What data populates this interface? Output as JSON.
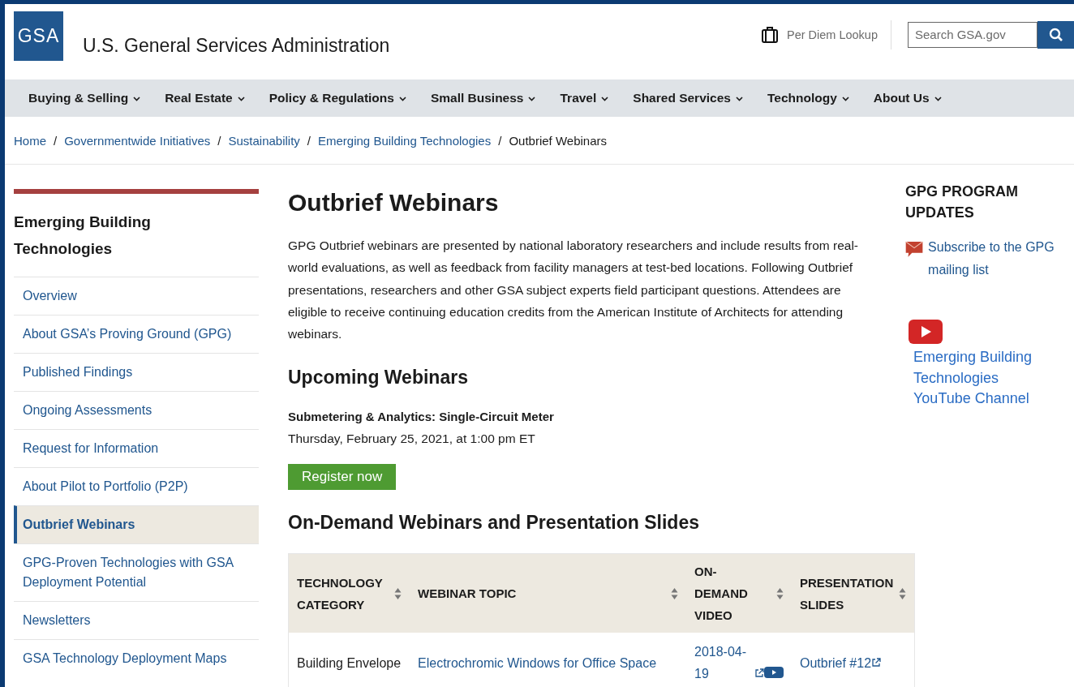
{
  "header": {
    "logo": "GSA",
    "title": "U.S. General Services Administration",
    "per_diem": "Per Diem Lookup",
    "search": {
      "placeholder": "Search GSA.gov"
    }
  },
  "nav": [
    {
      "label": "Buying & Selling"
    },
    {
      "label": "Real Estate"
    },
    {
      "label": "Policy & Regulations"
    },
    {
      "label": "Small Business"
    },
    {
      "label": "Travel"
    },
    {
      "label": "Shared Services"
    },
    {
      "label": "Technology"
    },
    {
      "label": "About Us"
    }
  ],
  "breadcrumb": [
    {
      "label": "Home",
      "current": false
    },
    {
      "separator": "/",
      "label": "Governmentwide Initiatives",
      "current": false
    },
    {
      "separator": "/",
      "label": "Sustainability",
      "current": false
    },
    {
      "separator": "/",
      "label": "Emerging Building Technologies",
      "current": false
    },
    {
      "separator": "/",
      "label": "Outbrief Webinars",
      "current": true
    }
  ],
  "sidebar": {
    "title": "Emerging Building Technologies",
    "items": [
      {
        "label": "Overview",
        "selected": false
      },
      {
        "label": "About GSA’s Proving Ground (GPG)",
        "selected": false
      },
      {
        "label": "Published Findings",
        "selected": false
      },
      {
        "label": "Ongoing Assessments",
        "selected": false
      },
      {
        "label": "Request for Information",
        "selected": false
      },
      {
        "label": "About Pilot to Portfolio (P2P)",
        "selected": false
      },
      {
        "label": "Outbrief Webinars",
        "selected": true
      },
      {
        "label": "GPG-Proven Technologies with GSA Deployment Potential",
        "selected": false
      },
      {
        "label": "Newsletters",
        "selected": false
      },
      {
        "label": "GSA Technology Deployment Maps",
        "selected": false
      }
    ]
  },
  "main": {
    "title": "Outbrief Webinars",
    "intro": "GPG Outbrief webinars are presented by national laboratory researchers and include results from real-world evaluations, as well as feedback from facility managers at test-bed locations. Following Outbrief presentations, researchers and other GSA subject experts field participant questions. Attendees are eligible to receive continuing education credits from the American Institute of Architects for attending webinars.",
    "upcoming": {
      "heading": "Upcoming Webinars",
      "event_title": "Submetering & Analytics: Single-Circuit Meter",
      "event_date": "Thursday, February 25, 2021, at 1:00 pm ET",
      "button": "Register now"
    },
    "table": {
      "heading": "On-Demand Webinars and Presentation Slides",
      "columns": [
        "TECHNOLOGY CATEGORY",
        "WEBINAR TOPIC",
        "ON-DEMAND VIDEO",
        "PRESENTATION SLIDES"
      ],
      "rows": [
        {
          "category": "Building Envelope",
          "topic": "Electrochromic Windows for Office Space",
          "video": "2018-04-19",
          "slides": "Outbrief #12"
        }
      ]
    }
  },
  "aside": {
    "heading": "GPG PROGRAM UPDATES",
    "subscribe": "Subscribe to the GPG mailing list",
    "youtube": "Emerging Building Technologies YouTube Channel"
  }
}
